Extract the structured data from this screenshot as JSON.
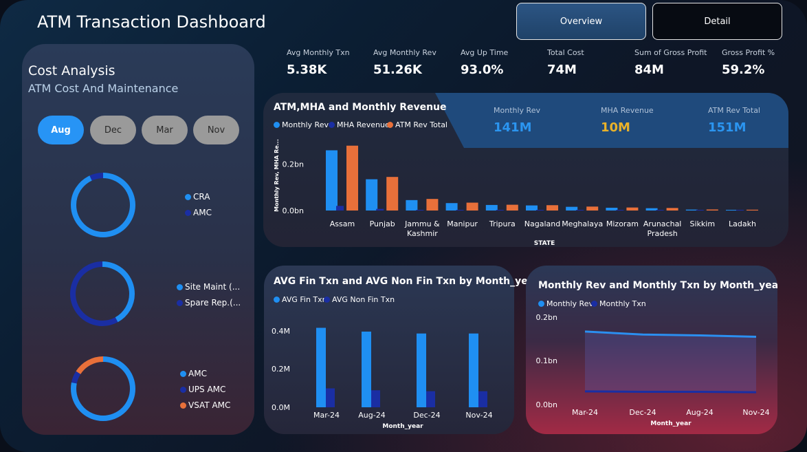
{
  "app": {
    "title": "ATM Transaction Dashboard"
  },
  "nav": {
    "overview_label": "Overview",
    "detail_label": "Detail"
  },
  "cost_panel": {
    "title": "Cost Analysis",
    "subtitle": "ATM Cost And Maintenance",
    "months": [
      {
        "label": "Aug",
        "active": true
      },
      {
        "label": "Dec",
        "active": false
      },
      {
        "label": "Mar",
        "active": false
      },
      {
        "label": "Nov",
        "active": false
      }
    ],
    "donut1": {
      "legend": [
        "CRA",
        "AMC"
      ],
      "values": [
        0.93,
        0.07
      ],
      "colors": [
        "#1f8ff2",
        "#1a2ea3"
      ]
    },
    "donut2": {
      "legend": [
        "Site Maint (...",
        "Spare Rep.(..."
      ],
      "values": [
        0.42,
        0.58
      ],
      "colors": [
        "#1f8ff2",
        "#1a2ea3"
      ]
    },
    "donut3": {
      "legend": [
        "AMC",
        "UPS AMC",
        "VSAT AMC"
      ],
      "values": [
        0.78,
        0.06,
        0.16
      ],
      "colors": [
        "#1f8ff2",
        "#1a2ea3",
        "#e8703a"
      ]
    }
  },
  "kpis": [
    {
      "label": "Avg Monthly Txn",
      "value": "5.38K"
    },
    {
      "label": "Avg Monthly Rev",
      "value": "51.26K"
    },
    {
      "label": "Avg Up Time",
      "value": "93.0%"
    },
    {
      "label": "Total Cost",
      "value": "74M"
    },
    {
      "label": "Sum of Gross Profit",
      "value": "84M"
    },
    {
      "label": "Gross Profit %",
      "value": "59.2%"
    }
  ],
  "state_chart": {
    "title": "ATM,MHA and Monthly Revenue",
    "legend": [
      "Monthly Rev",
      "MHA Revenue",
      "ATM Rev Total"
    ],
    "colors": {
      "monthly_rev": "#1f8ff2",
      "mha": "#1a2ea3",
      "atm": "#e8703a"
    },
    "kpis": [
      {
        "label": "Monthly Rev",
        "value": "141M",
        "color": "#2b95f0"
      },
      {
        "label": "MHA Revenue",
        "value": "10M",
        "color": "#e9b22a"
      },
      {
        "label": "ATM Rev Total",
        "value": "151M",
        "color": "#2b95f0"
      }
    ]
  },
  "fin_chart": {
    "title": "AVG Fin Txn and AVG Non Fin Txn by Month_year",
    "legend": [
      "AVG Fin Txn",
      "AVG Non Fin Txn"
    ]
  },
  "rev_chart": {
    "title": "Monthly Rev and Monthly Txn by Month_year",
    "legend": [
      "Monthly Rev",
      "Monthly Txn"
    ]
  },
  "chart_data": [
    {
      "type": "bar",
      "title": "ATM,MHA and Monthly Revenue",
      "xlabel": "STATE",
      "ylabel": "Monthly Rev, MHA Re...",
      "ylim": [
        0,
        0.3
      ],
      "yticks": [
        "0.2bn",
        "0.0bn"
      ],
      "categories": [
        "Assam",
        "Punjab",
        "Jammu & Kashmir",
        "Manipur",
        "Tripura",
        "Nagaland",
        "Meghalaya",
        "Mizoram",
        "Arunachal Pradesh",
        "Sikkim",
        "Ladakh"
      ],
      "series": [
        {
          "name": "Monthly Rev",
          "values": [
            0.26,
            0.135,
            0.045,
            0.032,
            0.024,
            0.022,
            0.016,
            0.012,
            0.01,
            0.004,
            0.003
          ]
        },
        {
          "name": "MHA Revenue",
          "values": [
            0.02,
            0.007,
            0.002,
            0.002,
            0.001,
            0.001,
            0.001,
            0.001,
            0.001,
            0.0005,
            0.0005
          ]
        },
        {
          "name": "ATM Rev Total",
          "values": [
            0.28,
            0.145,
            0.05,
            0.034,
            0.025,
            0.023,
            0.017,
            0.013,
            0.011,
            0.0045,
            0.0035
          ]
        }
      ]
    },
    {
      "type": "bar",
      "title": "AVG Fin Txn and AVG Non Fin Txn by Month_year",
      "xlabel": "Month_year",
      "ylim": [
        0,
        0.48
      ],
      "yticks": [
        "0.4M",
        "0.2M",
        "0.0M"
      ],
      "categories": [
        "Mar-24",
        "Aug-24",
        "Dec-24",
        "Nov-24"
      ],
      "series": [
        {
          "name": "AVG Fin Txn",
          "values": [
            0.42,
            0.4,
            0.39,
            0.39
          ]
        },
        {
          "name": "AVG Non Fin Txn",
          "values": [
            0.1,
            0.09,
            0.085,
            0.085
          ]
        }
      ]
    },
    {
      "type": "area",
      "title": "Monthly Rev and Monthly Txn by Month_year",
      "xlabel": "Month_year",
      "ylim": [
        0,
        0.2
      ],
      "yticks": [
        "0.2bn",
        "0.1bn",
        "0.0bn"
      ],
      "categories": [
        "Mar-24",
        "Dec-24",
        "Aug-24",
        "Nov-24"
      ],
      "series": [
        {
          "name": "Monthly Rev",
          "values": [
            0.153,
            0.146,
            0.144,
            0.141
          ]
        },
        {
          "name": "Monthly Txn",
          "values": [
            0.016,
            0.015,
            0.015,
            0.014
          ]
        }
      ]
    }
  ]
}
